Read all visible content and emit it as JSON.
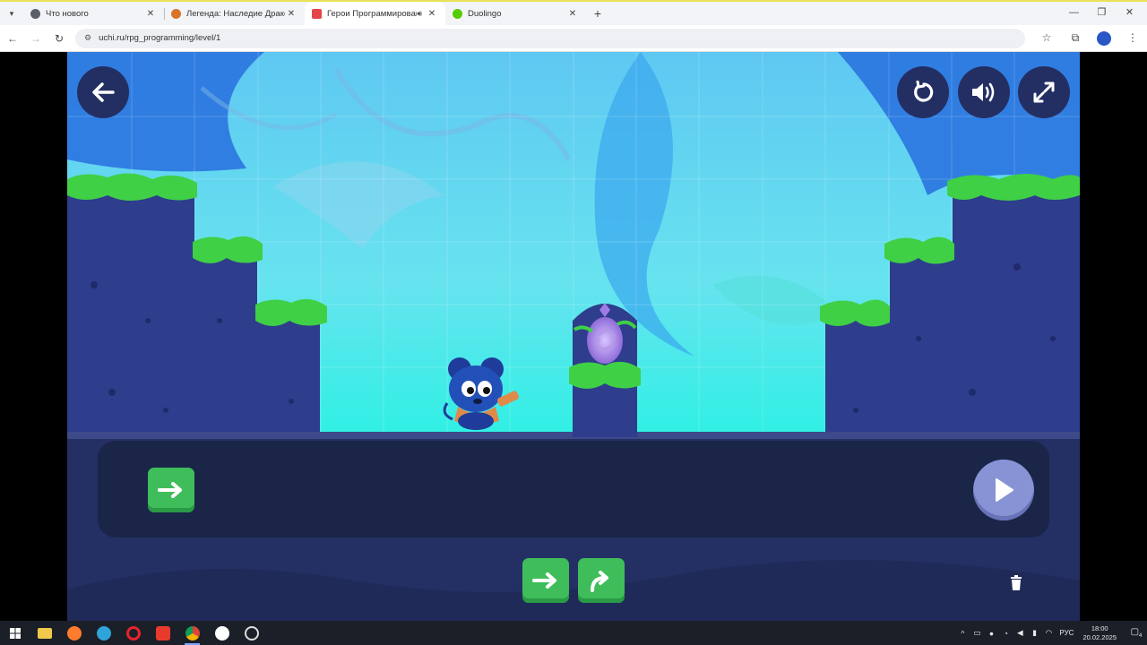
{
  "browser": {
    "tabs": [
      {
        "title": "Что нового",
        "favicon_color": "#5a5f6a"
      },
      {
        "title": "Легенда: Наследие Драконов",
        "favicon_color": "#d8752a"
      },
      {
        "title": "Герои Программирования",
        "favicon_color": "#e2464a",
        "active": true
      },
      {
        "title": "Duolingo",
        "favicon_color": "#58cc02"
      }
    ],
    "url": "uchi.ru/rpg_programming/level/1"
  },
  "game": {
    "controls": {
      "back": "arrow-left-icon",
      "restart": "restart-icon",
      "sound": "sound-icon",
      "fullscreen": "fullscreen-icon"
    },
    "program_blocks": [
      {
        "type": "move-right",
        "icon": "arrow-right-icon"
      }
    ],
    "palette_blocks": [
      {
        "type": "move-right",
        "icon": "arrow-right-icon"
      },
      {
        "type": "jump",
        "icon": "jump-arrow-icon"
      }
    ],
    "colors": {
      "block": "#3fbd5a",
      "panel": "#1a2548",
      "run": "#8893d6"
    }
  },
  "taskbar": {
    "language": "РУС",
    "time": "18:00",
    "date": "20.02.2025",
    "notifications": "4"
  }
}
